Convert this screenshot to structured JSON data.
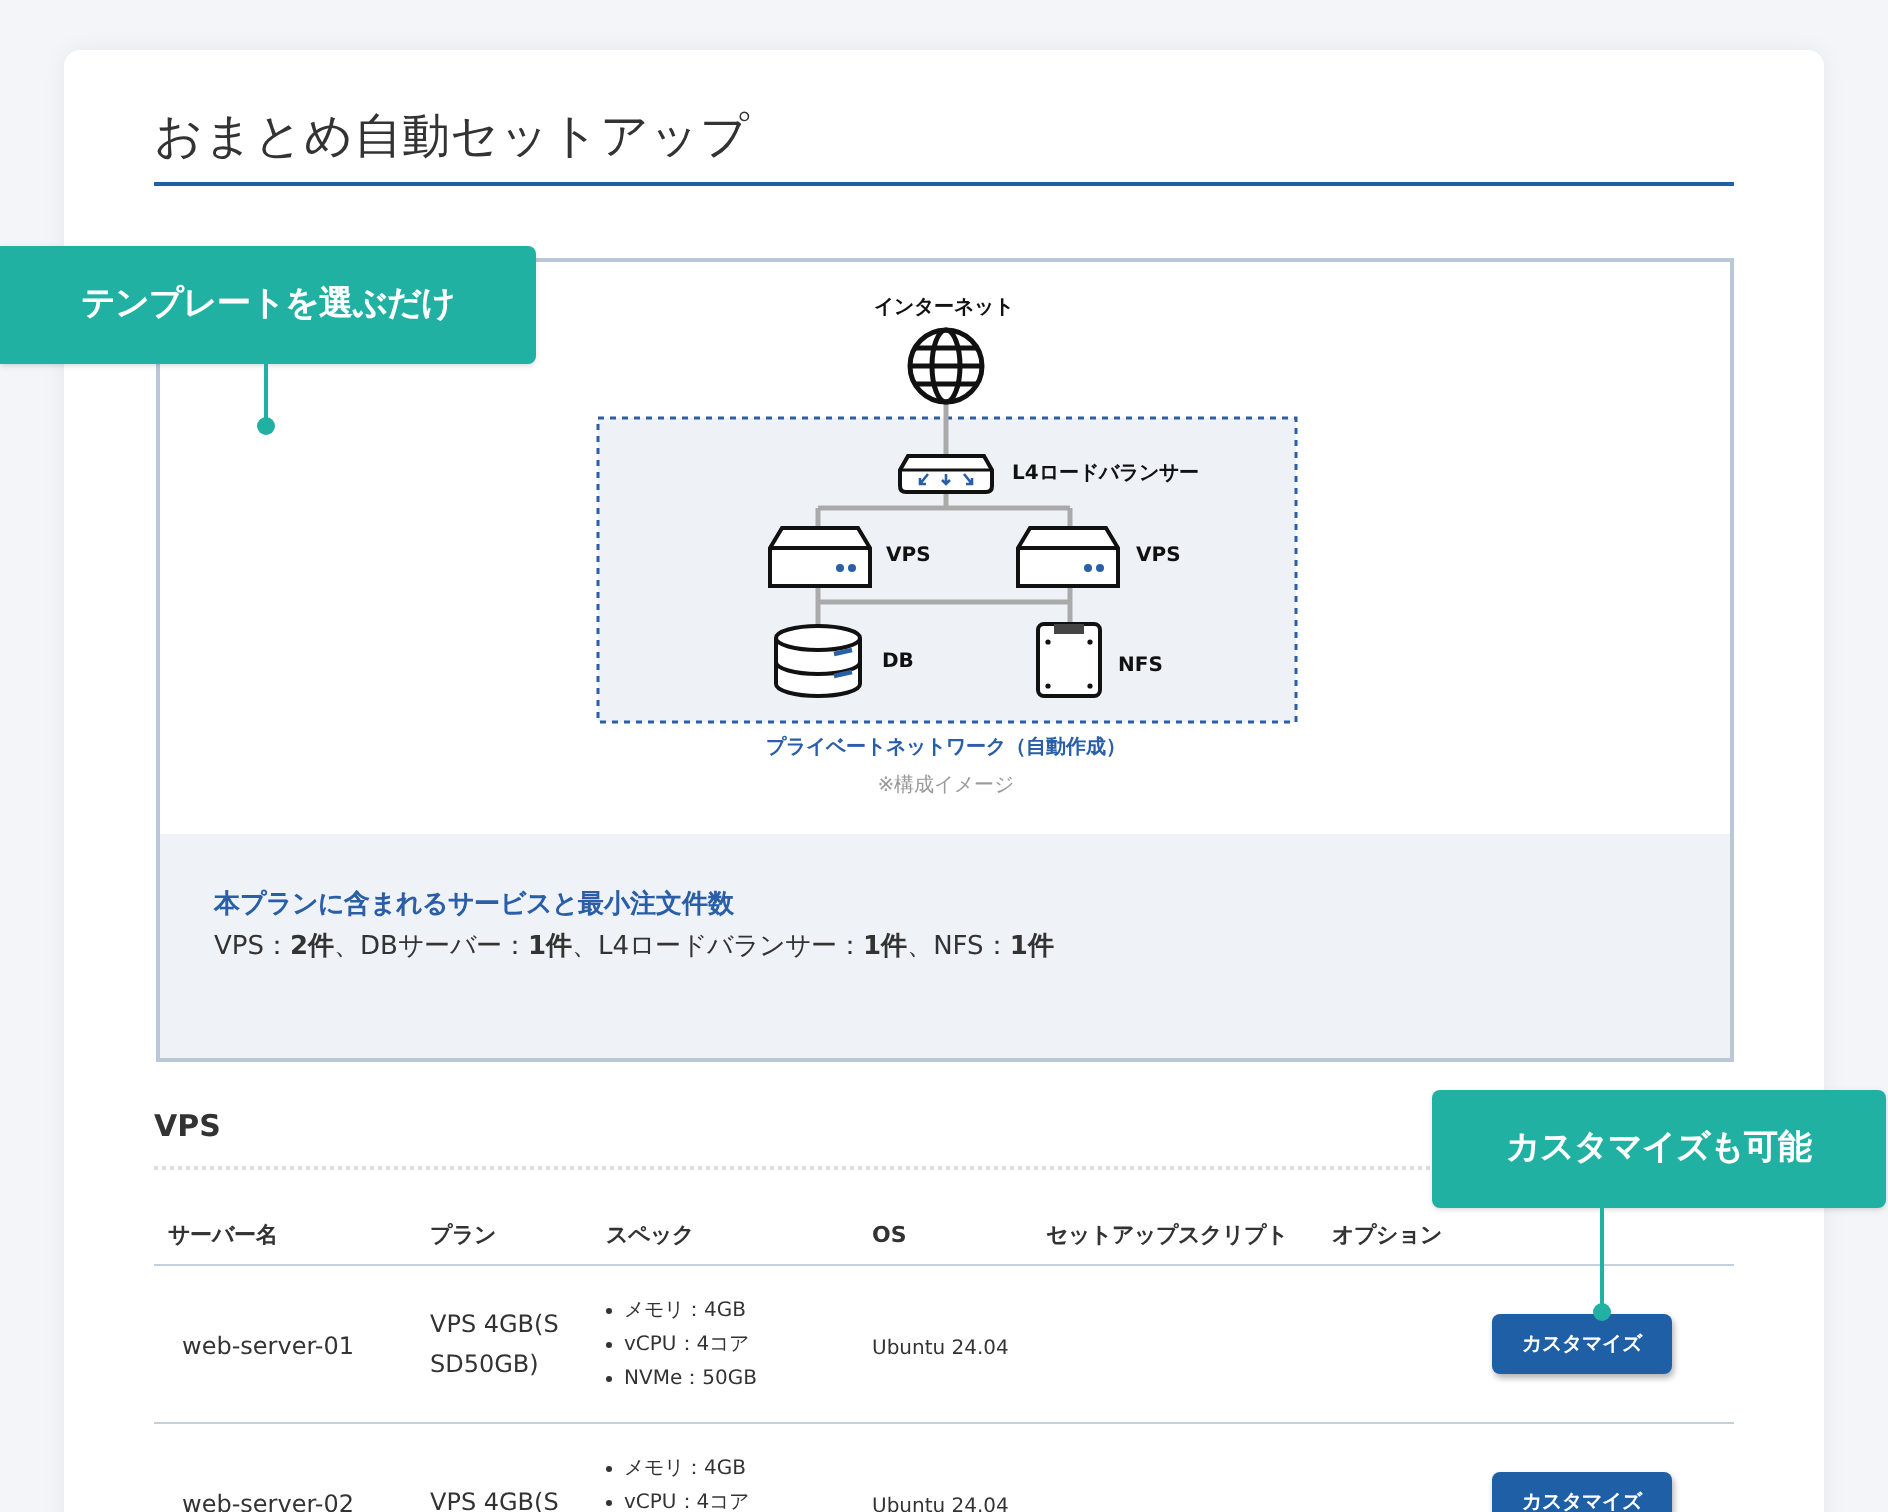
{
  "page": {
    "title": "おまとめ自動セットアップ"
  },
  "callouts": [
    {
      "text": "テンプレートを選ぶだけ"
    },
    {
      "text": "カスタマイズも可能"
    }
  ],
  "diagram": {
    "internet": "インターネット",
    "load_balancer": "L4ロードバランサー",
    "vps_left": "VPS",
    "vps_right": "VPS",
    "db": "DB",
    "nfs": "NFS",
    "network": "プライベートネットワーク（自動作成）",
    "caption": "※構成イメージ"
  },
  "summary": {
    "heading": "本プランに含まれるサービスと最小注文件数",
    "text": "VPS：**2件**、DBサーバー：**1件**、L4ロードバランサー：**1件**、NFS：**1件**"
  },
  "section": {
    "title": "VPS"
  },
  "table": {
    "columns": [
      "サーバー名",
      "プラン",
      "スペック",
      "OS",
      "セットアップスクリプト",
      "オプション"
    ],
    "rows": [
      {
        "server": "web-server-01",
        "plan": "VPS 4GB(SSD50GB)",
        "specs": [
          "メモリ：4GB",
          "vCPU：4コア",
          "NVMe：50GB"
        ],
        "os": "Ubuntu 24.04",
        "button": "カスタマイズ"
      },
      {
        "server": "web-server-02",
        "plan": "VPS 4GB(S",
        "specs": [
          "メモリ：4GB",
          "vCPU：4コア"
        ],
        "os": "Ubuntu 24.04",
        "button": "カスタマイズ"
      }
    ]
  }
}
